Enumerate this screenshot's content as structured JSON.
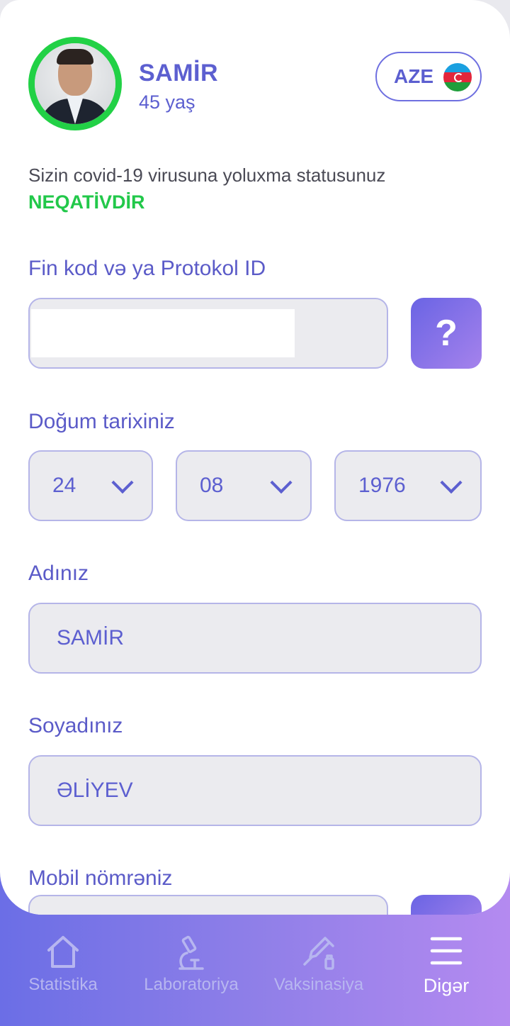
{
  "profile": {
    "name": "SAMİR",
    "age": "45 yaş"
  },
  "language": {
    "code": "AZE",
    "flag_icon": "azerbaijan-flag-icon"
  },
  "status": {
    "text": "Sizin covid-19 virusuna yoluxma statusunuz",
    "value": "NEQATİVDİR",
    "value_color": "#22c84a"
  },
  "form": {
    "fin_label": "Fin kod və ya Protokol ID",
    "fin_value": "",
    "help_label": "?",
    "birth_label": "Doğum tarixiniz",
    "birth_day": "24",
    "birth_month": "08",
    "birth_year": "1976",
    "name_label": "Adınız",
    "name_value": "SAMİR",
    "surname_label": "Soyadınız",
    "surname_value": "ƏLİYEV",
    "mobile_label": "Mobil nömrəniz"
  },
  "nav": {
    "items": [
      {
        "label": "Statistika",
        "icon": "home-icon"
      },
      {
        "label": "Laboratoriya",
        "icon": "microscope-icon"
      },
      {
        "label": "Vaksinasiya",
        "icon": "syringe-icon"
      },
      {
        "label": "Digər",
        "icon": "menu-icon"
      }
    ],
    "active": "Digər"
  },
  "colors": {
    "accent": "#5c5fd0",
    "avatar_ring": "#22d146",
    "nav_gradient_start": "#6b6ee6",
    "nav_gradient_end": "#b48af0"
  }
}
